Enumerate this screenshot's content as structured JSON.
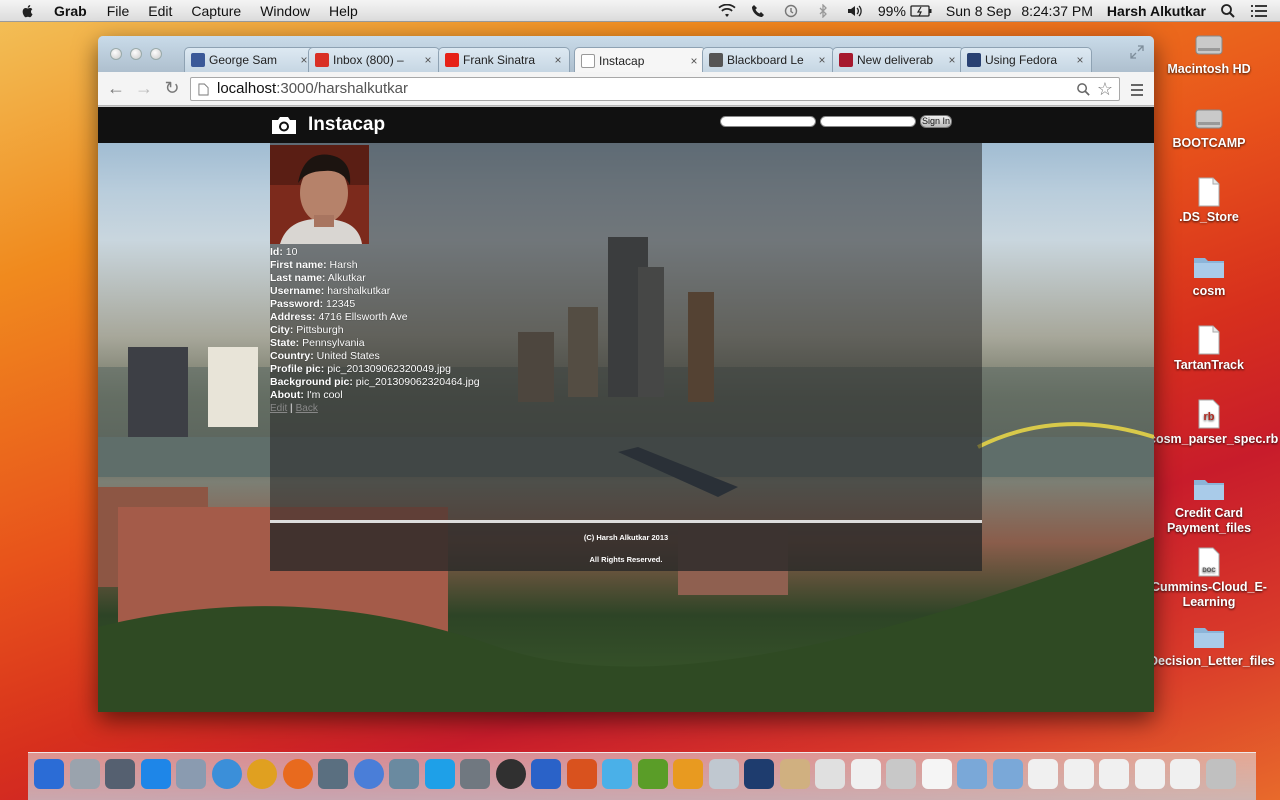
{
  "menubar": {
    "app": "Grab",
    "menus": [
      "File",
      "Edit",
      "Capture",
      "Window",
      "Help"
    ],
    "battery": "99%",
    "date": "Sun 8 Sep",
    "time": "8:24:37 PM",
    "user": "Harsh Alkutkar"
  },
  "desktop": {
    "icons": [
      {
        "label": "Macintosh HD",
        "icon": "hard-drive-icon"
      },
      {
        "label": "BOOTCAMP",
        "icon": "hard-drive-icon"
      },
      {
        "label": ".DS_Store",
        "icon": "file-icon"
      },
      {
        "label": "cosm",
        "icon": "folder-icon"
      },
      {
        "label": "TartanTrack",
        "icon": "file-icon"
      },
      {
        "label": "cosm_parser_spec.rb",
        "icon": "ruby-file-icon"
      },
      {
        "label": "Credit Card Payment_files",
        "icon": "folder-icon"
      },
      {
        "label": "Cummins-Cloud_E-Learning",
        "icon": "doc-file-icon"
      },
      {
        "label": "Decision_Letter_files",
        "icon": "folder-icon"
      }
    ]
  },
  "browser": {
    "tabs": [
      {
        "title": "George Sam",
        "favicon": "facebook-icon",
        "color": "#3b5998"
      },
      {
        "title": "Inbox (800) –",
        "favicon": "gmail-icon",
        "color": "#d93025"
      },
      {
        "title": "Frank Sinatra",
        "favicon": "youtube-icon",
        "color": "#e62117"
      },
      {
        "title": "Instacap",
        "favicon": "page-icon",
        "color": "#ffffff"
      },
      {
        "title": "Blackboard Le",
        "favicon": "blackboard-icon",
        "color": "#555555"
      },
      {
        "title": "New deliverab",
        "favicon": "c-icon",
        "color": "#a6192e"
      },
      {
        "title": "Using Fedora",
        "favicon": "fedora-icon",
        "color": "#294172"
      }
    ],
    "active_tab_index": 3,
    "url_host": "localhost",
    "url_rest": ":3000/harshalkutkar"
  },
  "page": {
    "brand": "Instacap",
    "signin_label": "Sign In",
    "profile": [
      {
        "label": "Id:",
        "value": "10"
      },
      {
        "label": "First name:",
        "value": "Harsh"
      },
      {
        "label": "Last name:",
        "value": "Alkutkar"
      },
      {
        "label": "Username:",
        "value": "harshalkutkar"
      },
      {
        "label": "Password:",
        "value": "12345"
      },
      {
        "label": "Address:",
        "value": "4716 Ellsworth Ave"
      },
      {
        "label": "City:",
        "value": "Pittsburgh"
      },
      {
        "label": "State:",
        "value": "Pennsylvania"
      },
      {
        "label": "Country:",
        "value": "United States"
      },
      {
        "label": "Profile pic:",
        "value": "pic_201309062320049.jpg"
      },
      {
        "label": "Background pic:",
        "value": "pic_201309062320464.jpg"
      },
      {
        "label": "About:",
        "value": "I'm cool"
      }
    ],
    "edit_link": "Edit",
    "separator": "|",
    "back_link": "Back",
    "footer_line1": "(C) Harsh Alkutkar 2013",
    "footer_line2": "All Rights Reserved."
  },
  "dock": {
    "items": [
      "finder-icon",
      "launchpad-icon",
      "system-icon",
      "app-store-icon",
      "preview-icon",
      "safari-icon",
      "chrome-icon",
      "firefox-icon",
      "facetime-icon",
      "itunes-icon",
      "iphoto-icon",
      "skype-icon",
      "utility-icon",
      "camera-icon",
      "word-icon",
      "powerpoint-icon",
      "messages-icon",
      "dreamweaver-icon",
      "illustrator-icon",
      "photos-icon",
      "photoshop-icon",
      "user-icon",
      "database-icon",
      "textedit-icon",
      "grab-icon",
      "document-icon",
      "folder-icon",
      "folder-icon",
      "window-icon",
      "window-icon",
      "window-icon",
      "window-icon",
      "window-icon",
      "trash-icon"
    ],
    "colors": [
      "#2b6cd6",
      "#9aa3ad",
      "#556070",
      "#1e86e8",
      "#8a9bb0",
      "#3b8fd9",
      "#e0a020",
      "#e86a1e",
      "#5a6f80",
      "#4a7ed8",
      "#6a8aa0",
      "#1ea0e8",
      "#707880",
      "#303030",
      "#2a62c8",
      "#d9521e",
      "#4ab0e8",
      "#5a9d28",
      "#e89a20",
      "#c0c8d0",
      "#1e3c6e",
      "#d0b080",
      "#e0e0e0",
      "#f0f0f0",
      "#c8c8c8",
      "#f5f5f5",
      "#7aa8d8",
      "#7aa8d8",
      "#f0f0f0",
      "#f0f0f0",
      "#f0f0f0",
      "#f0f0f0",
      "#f0f0f0",
      "#c0c0c0"
    ]
  }
}
